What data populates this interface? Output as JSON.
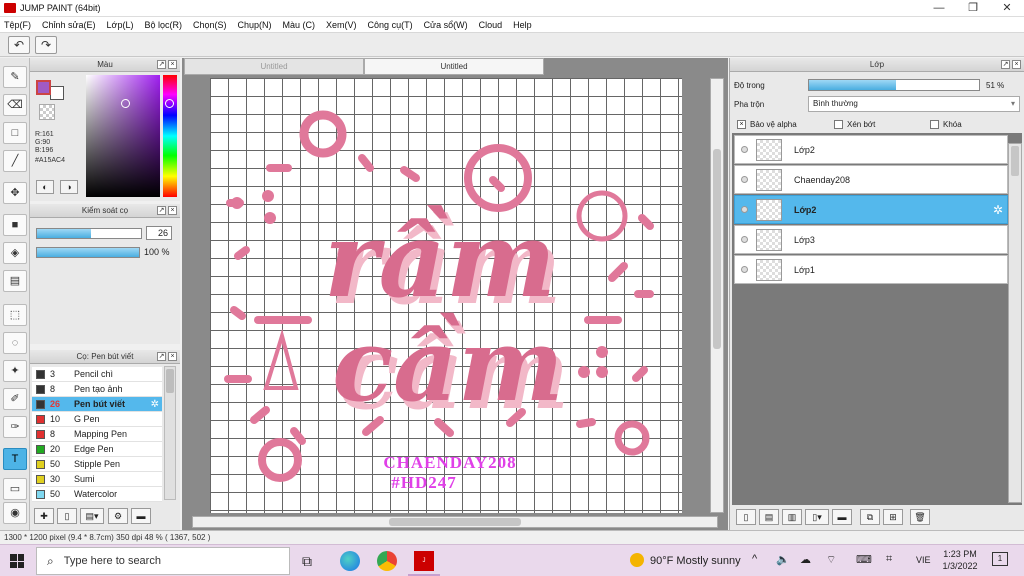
{
  "window": {
    "title": "JUMP PAINT (64bit)",
    "minimize": "—",
    "maximize": "❐",
    "close": "✕"
  },
  "menu": [
    "Tệp(F)",
    "Chỉnh sửa(E)",
    "Lớp(L)",
    "Bộ lọc(R)",
    "Chọn(S)",
    "Chụp(N)",
    "Màu (C)",
    "Xem(V)",
    "Công cụ(T)",
    "Cửa sổ(W)",
    "Cloud",
    "Help"
  ],
  "toolbar": {
    "undo_icon": "undo-arrow",
    "redo_icon": "redo-arrow"
  },
  "color_panel": {
    "title": "Màu",
    "r": "R:161",
    "g": "G:90",
    "b": "B:196",
    "hex": "#A15AC4",
    "primary_color": "#A15AC4"
  },
  "brush_control": {
    "title": "Kiểm soát cọ",
    "size_value": "26",
    "size_fill": 0.52,
    "opacity_value": "100 %",
    "opacity_fill": 1.0
  },
  "brush_list": {
    "title": "Cọ: Pen bút viết",
    "items": [
      {
        "num": "3",
        "name": "Pencil chì",
        "color": "#333333"
      },
      {
        "num": "8",
        "name": "Pen tạo ảnh",
        "color": "#333333"
      },
      {
        "num": "26",
        "name": "Pen bút viết",
        "color": "#333333",
        "selected": true
      },
      {
        "num": "10",
        "name": "G Pen",
        "color": "#e03030"
      },
      {
        "num": "8",
        "name": "Mapping Pen",
        "color": "#e03030"
      },
      {
        "num": "20",
        "name": "Edge Pen",
        "color": "#22aa22"
      },
      {
        "num": "50",
        "name": "Stipple Pen",
        "color": "#e0d020"
      },
      {
        "num": "30",
        "name": "Sumi",
        "color": "#e0d020"
      },
      {
        "num": "50",
        "name": "Watercolor",
        "color": "#80d8f0"
      }
    ]
  },
  "doc_tabs": [
    {
      "label": "Untitled"
    },
    {
      "label": "Untitled"
    }
  ],
  "artwork": {
    "line1": "rầm",
    "line2": "cầm",
    "credit1": "CHAENDAY208",
    "credit2": "#HD247",
    "pink": "#e0789a",
    "magenta": "#e040e8"
  },
  "layer_panel": {
    "title": "Lớp",
    "opacity_label": "Độ trong",
    "opacity_value": "51 %",
    "opacity_fill": 0.51,
    "blend_label": "Pha trộn",
    "blend_value": "Bình thường",
    "protect_alpha": "Bảo vệ alpha",
    "clipping": "Xén bớt",
    "lock": "Khóa",
    "layers": [
      {
        "name": "Lớp2"
      },
      {
        "name": "Chaenday208"
      },
      {
        "name": "Lớp2",
        "selected": true
      },
      {
        "name": "Lớp3"
      },
      {
        "name": "Lớp1"
      }
    ]
  },
  "status": "1300 * 1200 pixel  (9.4 * 8.7cm)  350 dpi  48 %  ( 1367, 502 )",
  "taskbar": {
    "search_placeholder": "Type here to search",
    "weather": "90°F  Mostly sunny",
    "lang": "VIE",
    "time": "1:23 PM",
    "date": "1/3/2022",
    "notif": "1"
  }
}
